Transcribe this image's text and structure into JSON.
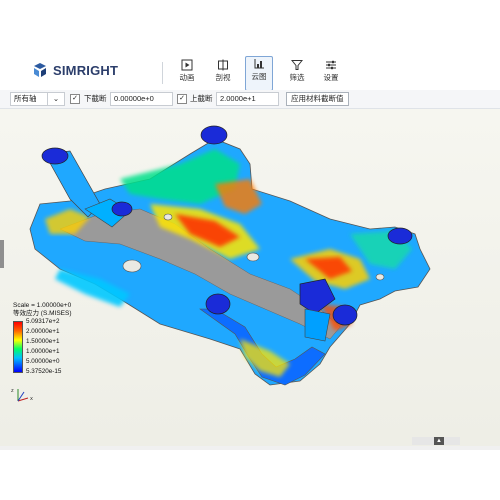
{
  "header": {
    "brand": "SIMRIGHT",
    "tools": [
      {
        "label": "动画",
        "icon": "play-frame-icon"
      },
      {
        "label": "剖视",
        "icon": "section-view-icon"
      },
      {
        "label": "云图",
        "icon": "contour-plot-icon",
        "active": true
      },
      {
        "label": "筛选",
        "icon": "filter-icon"
      },
      {
        "label": "设置",
        "icon": "settings-sliders-icon"
      }
    ]
  },
  "toolbar": {
    "part_select": "所有轴",
    "lower_cut_checked": true,
    "lower_cut_label": "下截断",
    "lower_cut_value": "0.00000e+0",
    "upper_cut_checked": true,
    "upper_cut_label": "上截断",
    "upper_cut_value": "2.0000e+1",
    "apply_label": "应用材料截断值"
  },
  "legend": {
    "scale": "Scale = 1.00000e+0",
    "title": "等效应力 (S.MISES)",
    "values": [
      "5.09317e+2",
      "2.00000e+1",
      "1.50000e+1",
      "1.00000e+1",
      "5.00000e+0",
      "5.37520e-15"
    ]
  },
  "colors": {
    "accent": "#7fa6d6",
    "brand_blue": "#2c5aa0",
    "contour_high": "#ff0000",
    "contour_low": "#0000ff"
  }
}
